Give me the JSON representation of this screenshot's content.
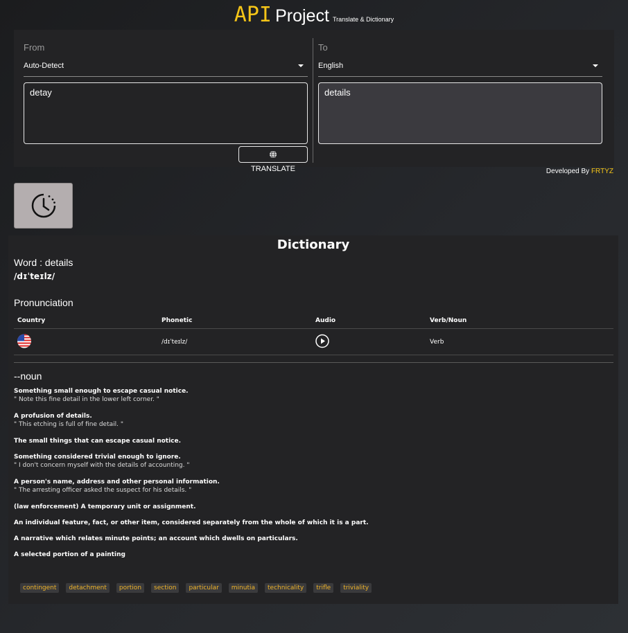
{
  "header": {
    "brand": "API",
    "title": "Project",
    "subtitle": "Translate & Dictionary"
  },
  "translator": {
    "from_label": "From",
    "from_language": "Auto-Detect",
    "from_text": "detay",
    "to_label": "To",
    "to_language": "English",
    "to_text": "details",
    "translate_label": "TRANSLATE",
    "icons": {
      "translate": "globe-icon",
      "caret": "chevron-down-icon"
    }
  },
  "developer": {
    "prefix": "Developed By",
    "name": "FRTYZ"
  },
  "history": {
    "icon": "history-clock-icon"
  },
  "dictionary": {
    "title": "Dictionary",
    "word_line": "Word : details",
    "phonetic": "/dɪˈteɪlz/",
    "pronunciation_title": "Pronunciation",
    "table": {
      "headers": [
        "Country",
        "Phonetic",
        "Audio",
        "Verb/Noun"
      ],
      "row": {
        "country_icon": "us-flag-icon",
        "phonetic": "/dɪˈteɪlz/",
        "audio_icon": "play-icon",
        "type": "Verb"
      }
    },
    "part_of_speech": "--noun",
    "definitions": [
      {
        "text": "Something small enough to escape casual notice.",
        "example": "\" Note this fine detail in the lower left corner. \""
      },
      {
        "text": "A profusion of details.",
        "example": "\" This etching is full of fine detail. \""
      },
      {
        "text": "The small things that can escape casual notice.",
        "example": ""
      },
      {
        "text": "Something considered trivial enough to ignore.",
        "example": "\" I don't concern myself with the details of accounting. \""
      },
      {
        "text": "A person's name, address and other personal information.",
        "example": "\" The arresting officer asked the suspect for his details. \""
      },
      {
        "text": "(law enforcement) A temporary unit or assignment.",
        "example": ""
      },
      {
        "text": "An individual feature, fact, or other item, considered separately from the whole of which it is a part.",
        "example": ""
      },
      {
        "text": "A narrative which relates minute points; an account which dwells on particulars.",
        "example": ""
      },
      {
        "text": "A selected portion of a painting",
        "example": ""
      }
    ],
    "synonyms": [
      "contingent",
      "detachment",
      "portion",
      "section",
      "particular",
      "minutia",
      "technicality",
      "trifle",
      "triviality"
    ]
  },
  "colors": {
    "accent": "#f5c518",
    "panel": "#232325",
    "chip_text": "#f0b429"
  }
}
